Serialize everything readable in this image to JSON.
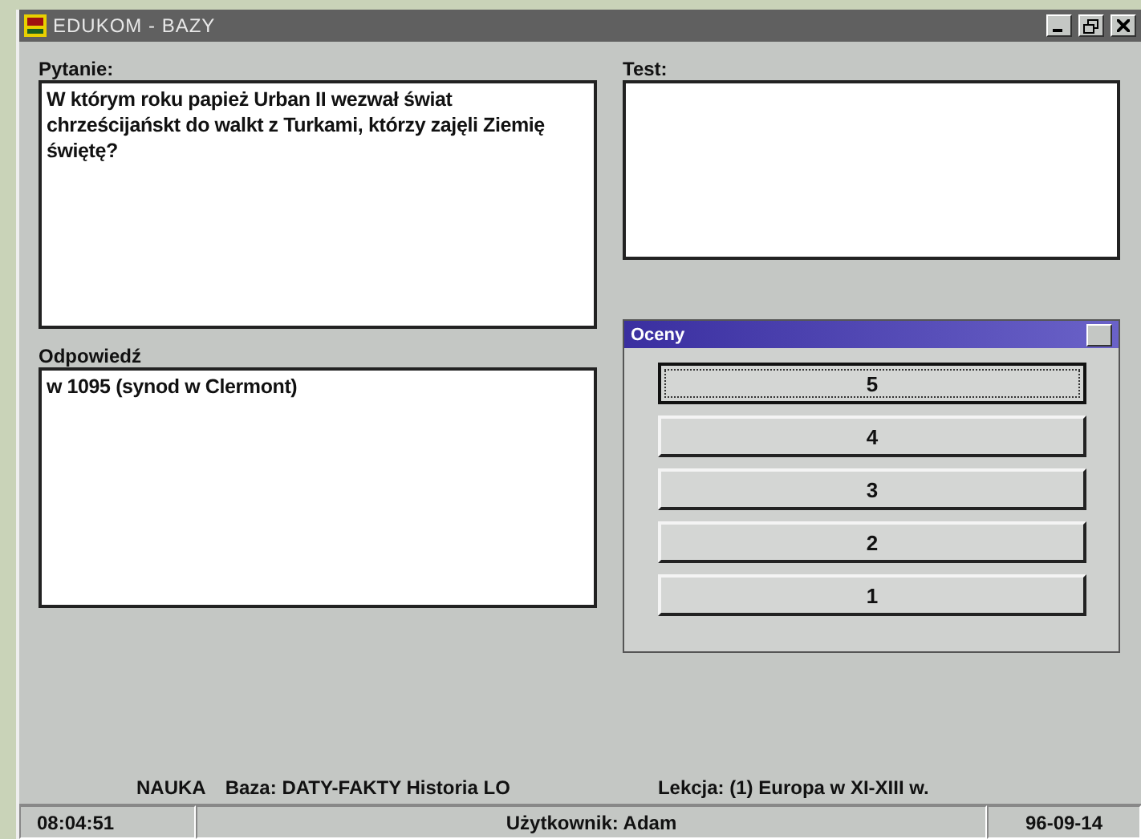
{
  "window": {
    "title": "EDUKOM - BAZY",
    "active": false
  },
  "question": {
    "label": "Pytanie:",
    "value": "W którym roku papież Urban II wezwał świat chrześcijańskt do walkt z Turkami, którzy zajęli Ziemię świętę?"
  },
  "test": {
    "label": "Test:"
  },
  "answer": {
    "label": "Odpowiedź",
    "value": "w 1095 (synod w Clermont)"
  },
  "grades_dialog": {
    "title": "Oceny",
    "buttons": [
      {
        "label": "5",
        "selected": true
      },
      {
        "label": "4",
        "selected": false
      },
      {
        "label": "3",
        "selected": false
      },
      {
        "label": "2",
        "selected": false
      },
      {
        "label": "1",
        "selected": false
      }
    ]
  },
  "info_line": {
    "mode": "NAUKA",
    "database": "Baza: DATY-FAKTY Historia LO",
    "lesson": "Lekcja: (1) Europa w XI-XIII w."
  },
  "status_bar": {
    "time": "08:04:51",
    "user": "Użytkownik: Adam",
    "date": "96-09-14"
  }
}
